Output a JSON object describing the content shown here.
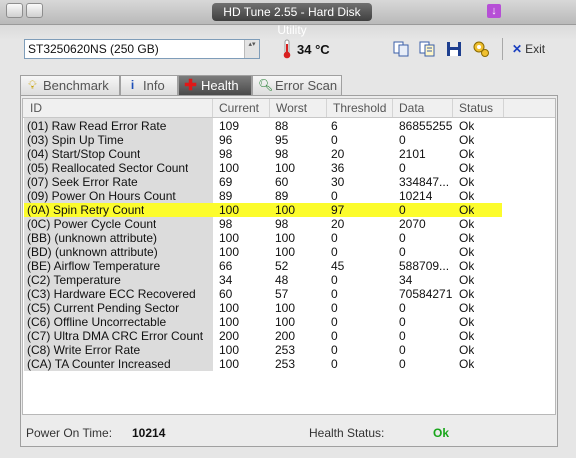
{
  "window": {
    "title": "HD Tune 2.55 - Hard Disk Utility"
  },
  "toolbar": {
    "drive": "ST3250620NS (250 GB)",
    "temperature": "34 °C",
    "exit_label": "Exit",
    "icons": [
      "copy-icon",
      "copy-all-icon",
      "save-icon",
      "options-icon",
      "exit-icon"
    ]
  },
  "tabs": [
    {
      "label": "Benchmark",
      "icon": "benchmark-icon",
      "active": false
    },
    {
      "label": "Info",
      "icon": "info-icon",
      "active": false
    },
    {
      "label": "Health",
      "icon": "health-icon",
      "active": true
    },
    {
      "label": "Error Scan",
      "icon": "error-scan-icon",
      "active": false
    }
  ],
  "table": {
    "columns": [
      "ID",
      "Current",
      "Worst",
      "Threshold",
      "Data",
      "Status"
    ],
    "rows": [
      [
        "(01) Raw Read Error Rate",
        "109",
        "88",
        "6",
        "86855255",
        "Ok"
      ],
      [
        "(03) Spin Up Time",
        "96",
        "95",
        "0",
        "0",
        "Ok"
      ],
      [
        "(04) Start/Stop Count",
        "98",
        "98",
        "20",
        "2101",
        "Ok"
      ],
      [
        "(05) Reallocated Sector Count",
        "100",
        "100",
        "36",
        "0",
        "Ok"
      ],
      [
        "(07) Seek Error Rate",
        "69",
        "60",
        "30",
        "334847...",
        "Ok"
      ],
      [
        "(09) Power On Hours Count",
        "89",
        "89",
        "0",
        "10214",
        "Ok"
      ],
      [
        "(0A) Spin Retry Count",
        "100",
        "100",
        "97",
        "0",
        "Ok"
      ],
      [
        "(0C) Power Cycle Count",
        "98",
        "98",
        "20",
        "2070",
        "Ok"
      ],
      [
        "(BB) (unknown attribute)",
        "100",
        "100",
        "0",
        "0",
        "Ok"
      ],
      [
        "(BD) (unknown attribute)",
        "100",
        "100",
        "0",
        "0",
        "Ok"
      ],
      [
        "(BE) Airflow Temperature",
        "66",
        "52",
        "45",
        "588709...",
        "Ok"
      ],
      [
        "(C2) Temperature",
        "34",
        "48",
        "0",
        "34",
        "Ok"
      ],
      [
        "(C3) Hardware ECC Recovered",
        "60",
        "57",
        "0",
        "70584271",
        "Ok"
      ],
      [
        "(C5) Current Pending Sector",
        "100",
        "100",
        "0",
        "0",
        "Ok"
      ],
      [
        "(C6) Offline Uncorrectable",
        "100",
        "100",
        "0",
        "0",
        "Ok"
      ],
      [
        "(C7) Ultra DMA CRC Error Count",
        "200",
        "200",
        "0",
        "0",
        "Ok"
      ],
      [
        "(C8) Write Error Rate",
        "100",
        "253",
        "0",
        "0",
        "Ok"
      ],
      [
        "(CA) TA Counter Increased",
        "100",
        "253",
        "0",
        "0",
        "Ok"
      ]
    ],
    "highlight_row": 6,
    "highlight_color": "#fcfc2c"
  },
  "footer": {
    "power_on_label": "Power On Time:",
    "power_on_value": "10214",
    "health_label": "Health Status:",
    "health_value": "Ok",
    "health_color": "#19a61b"
  }
}
